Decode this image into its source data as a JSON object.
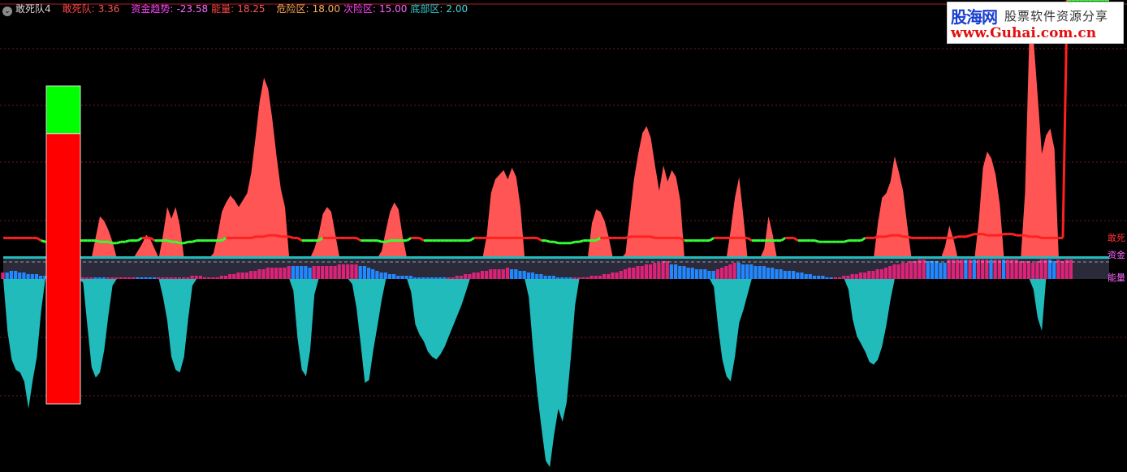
{
  "header": {
    "collapse_icon": "chevron-down-icon",
    "title": "敢死队4",
    "items": [
      {
        "label": "敢死队:",
        "value": "3.36",
        "color": "#ff4444"
      },
      {
        "label": "资金趋势:",
        "value": "-23.58",
        "color": "#ff44ff"
      },
      {
        "label": "能量:",
        "value": "18.25",
        "color": "#ff4444"
      },
      {
        "label": "危险区:",
        "value": "18.00",
        "color": "#ffaa55"
      },
      {
        "label": "次险区:",
        "value": "15.00",
        "color": "#ff44ff"
      },
      {
        "label": "底部区:",
        "value": "2.00",
        "color": "#33cccc"
      }
    ]
  },
  "watermark": {
    "line1": "股海网",
    "line1b": "股票软件资源分享",
    "line2": "www.Guhai.com.cn"
  },
  "right_labels": {
    "dare": "敢死",
    "fund": "资金",
    "energy": "能量"
  },
  "colors": {
    "dare_fill": "#ff5555",
    "fund_fill": "#22bbbb",
    "energy_pos": "#dd2277",
    "energy_neg": "#2288ff",
    "trend_pos": "#ff2020",
    "trend_neg": "#33ff33",
    "grid": "#7a1a1a"
  },
  "chart_data": {
    "type": "area",
    "series": [
      {
        "name": "敢死",
        "values": [
          0,
          0,
          0,
          0,
          0,
          0,
          0,
          0,
          0,
          0,
          0,
          0,
          0,
          0,
          0,
          0,
          0,
          0,
          0,
          0,
          0,
          0,
          9,
          18,
          16,
          12,
          7,
          0,
          0,
          0,
          0,
          0,
          3,
          6,
          10,
          8,
          4,
          0,
          10,
          22,
          17,
          22,
          14,
          0,
          0,
          0,
          0,
          0,
          0,
          0,
          2,
          10,
          20,
          24,
          27,
          25,
          22,
          25,
          28,
          37,
          52,
          68,
          78,
          73,
          60,
          44,
          30,
          22,
          0,
          0,
          0,
          0,
          0,
          0,
          4,
          10,
          19,
          22,
          20,
          10,
          0,
          0,
          0,
          0,
          0,
          0,
          0,
          0,
          0,
          0,
          3,
          12,
          20,
          24,
          21,
          9,
          0,
          0,
          0,
          0,
          0,
          0,
          0,
          0,
          0,
          0,
          0,
          0,
          0,
          0,
          0,
          0,
          0,
          0,
          0,
          10,
          28,
          34,
          36,
          38,
          34,
          39,
          35,
          22,
          0,
          0,
          0,
          0,
          0,
          0,
          0,
          0,
          0,
          0,
          0,
          0,
          0,
          0,
          0,
          0,
          15,
          21,
          20,
          16,
          9,
          0,
          0,
          0,
          2,
          18,
          34,
          45,
          54,
          57,
          52,
          40,
          29,
          40,
          33,
          38,
          35,
          25,
          0,
          0,
          0,
          0,
          0,
          0,
          0,
          0,
          0,
          0,
          0,
          12,
          26,
          35,
          18,
          0,
          0,
          0,
          0,
          4,
          18,
          10,
          0,
          0,
          0,
          0,
          0,
          0,
          0,
          0,
          0,
          0,
          0,
          0,
          0,
          0,
          0,
          0,
          0,
          0,
          0,
          0,
          0,
          0,
          0,
          0,
          15,
          26,
          28,
          33,
          44,
          37,
          29,
          14,
          0,
          0,
          0,
          0,
          0,
          0,
          0,
          0,
          5,
          14,
          8,
          0,
          0,
          0,
          0,
          0,
          16,
          39,
          46,
          43,
          36,
          23,
          0,
          0,
          0,
          0,
          0,
          28,
          95,
          95,
          70,
          45,
          53,
          56,
          47,
          0,
          0,
          0,
          0,
          0,
          0,
          0,
          0,
          0,
          0,
          0,
          0,
          0
        ],
        "color": "#ff5555"
      },
      {
        "name": "资金",
        "values": [
          0,
          -40,
          -62,
          -70,
          -72,
          -79,
          -100,
          -78,
          -60,
          -25,
          0,
          0,
          0,
          0,
          0,
          0,
          0,
          0,
          0,
          -3,
          -36,
          -68,
          -76,
          -72,
          -55,
          -28,
          -5,
          0,
          0,
          0,
          0,
          0,
          0,
          0,
          0,
          0,
          0,
          0,
          -14,
          -32,
          -60,
          -70,
          -72,
          -60,
          -30,
          -5,
          0,
          0,
          0,
          0,
          0,
          0,
          0,
          0,
          0,
          0,
          0,
          0,
          0,
          0,
          0,
          0,
          0,
          0,
          0,
          0,
          0,
          0,
          0,
          -9,
          -46,
          -70,
          -75,
          -55,
          -12,
          0,
          0,
          0,
          0,
          0,
          0,
          0,
          0,
          -4,
          -22,
          -50,
          -80,
          -78,
          -55,
          -36,
          -16,
          0,
          0,
          0,
          0,
          0,
          0,
          -10,
          -35,
          -43,
          -48,
          -56,
          -60,
          -62,
          -58,
          -52,
          -44,
          -36,
          -28,
          -20,
          -10,
          0,
          0,
          0,
          0,
          0,
          0,
          0,
          0,
          0,
          0,
          0,
          0,
          0,
          0,
          -14,
          -54,
          -88,
          -115,
          -140,
          -145,
          -120,
          -100,
          -110,
          -95,
          -60,
          -20,
          0,
          0,
          0,
          0,
          0,
          0,
          0,
          0,
          0,
          0,
          0,
          0,
          0,
          0,
          0,
          0,
          0,
          0,
          0,
          0,
          0,
          0,
          0,
          0,
          0,
          0,
          0,
          0,
          0,
          0,
          0,
          0,
          -6,
          -37,
          -62,
          -75,
          -79,
          -60,
          -34,
          -24,
          -12,
          0,
          0,
          0,
          0,
          0,
          0,
          0,
          0,
          0,
          0,
          0,
          0,
          0,
          0,
          0,
          0,
          0,
          0,
          0,
          0,
          0,
          0,
          0,
          -8,
          -31,
          -44,
          -50,
          -56,
          -64,
          -66,
          -62,
          -52,
          -36,
          -16,
          0,
          0,
          0,
          0,
          0,
          0,
          0,
          0,
          0,
          0,
          0,
          0,
          0,
          0,
          0,
          0,
          0,
          0,
          0,
          0,
          0,
          0,
          0,
          0,
          0,
          0,
          0,
          0,
          0,
          0,
          0,
          0,
          0,
          -8,
          -30,
          -40,
          0,
          0,
          0,
          0,
          0,
          0,
          0,
          0,
          0,
          0,
          0,
          0,
          0,
          0,
          0,
          0,
          0,
          0,
          0,
          0,
          0,
          0,
          0,
          0,
          0,
          0,
          0,
          -9,
          -52,
          -68,
          -94,
          -98,
          -86,
          -68,
          -48,
          0,
          0
        ],
        "color": "#22bbbb"
      },
      {
        "name": "能量",
        "values": [
          4,
          -4,
          -5,
          -5,
          -4,
          -4,
          -3,
          -3,
          -3,
          -2,
          -2,
          -1,
          -1,
          1,
          1,
          1,
          1,
          2,
          2,
          1,
          1,
          1,
          -1,
          -1,
          -1,
          1,
          1,
          1,
          1,
          1,
          1,
          1,
          -1,
          -1,
          -1,
          -1,
          -1,
          1,
          1,
          1,
          1,
          1,
          1,
          1,
          1,
          2,
          2,
          2,
          1,
          1,
          1,
          1,
          2,
          2,
          3,
          3,
          4,
          4,
          4,
          5,
          5,
          6,
          6,
          7,
          7,
          7,
          7,
          7,
          8,
          -8,
          -8,
          -8,
          -8,
          -7,
          8,
          8,
          8,
          8,
          8,
          8,
          9,
          9,
          9,
          9,
          9,
          -8,
          -8,
          -7,
          -6,
          -5,
          -4,
          -4,
          -3,
          -3,
          -2,
          -2,
          -2,
          -2,
          -1,
          -1,
          -1,
          -1,
          -1,
          -1,
          -1,
          -1,
          1,
          1,
          2,
          2,
          3,
          3,
          4,
          4,
          5,
          5,
          6,
          6,
          6,
          6,
          7,
          -6,
          -6,
          -5,
          -5,
          -4,
          -4,
          -3,
          -3,
          -2,
          -2,
          -2,
          -1,
          -1,
          -1,
          -1,
          1,
          1,
          1,
          1,
          2,
          2,
          2,
          3,
          3,
          4,
          4,
          5,
          6,
          7,
          7,
          8,
          8,
          9,
          9,
          10,
          10,
          11,
          11,
          -9,
          -9,
          -8,
          -8,
          -7,
          -7,
          -6,
          -6,
          -6,
          -5,
          -5,
          6,
          7,
          8,
          9,
          10,
          -10,
          -9,
          -9,
          -9,
          -8,
          -8,
          -8,
          -7,
          -7,
          -6,
          -6,
          -5,
          -5,
          -5,
          -4,
          -4,
          -3,
          -3,
          -2,
          -2,
          -2,
          -1,
          -1,
          1,
          1,
          2,
          2,
          3,
          3,
          4,
          4,
          5,
          5,
          6,
          6,
          7,
          8,
          9,
          9,
          10,
          10,
          11,
          11,
          12,
          12,
          -11,
          -11,
          -11,
          -10,
          -10,
          12,
          12,
          13,
          13,
          -12,
          12,
          -12,
          13,
          13,
          13,
          -13,
          13,
          13,
          -13,
          12,
          12,
          12,
          11,
          11,
          11,
          10,
          11,
          12,
          13,
          -12,
          -11,
          12,
          11,
          13,
          13
        ],
        "color": "#dd2277"
      },
      {
        "name": "资金趋势",
        "values": [
          1,
          1,
          1,
          1,
          1,
          1,
          1,
          1,
          1,
          -1,
          -2,
          -2,
          -2,
          -1,
          -1,
          -1,
          -1,
          -1,
          -1,
          -1,
          -1,
          -1,
          -1,
          -2,
          -2,
          -2,
          -3,
          -3,
          -2,
          -2,
          -1,
          -1,
          -1,
          1,
          1,
          1,
          -1,
          -1,
          -1,
          -1,
          -2,
          -2,
          -3,
          -3,
          -2,
          -2,
          -1,
          -1,
          -1,
          -1,
          -1,
          -1,
          -1,
          1,
          1,
          1,
          1,
          1,
          1,
          1,
          2,
          2,
          2,
          3,
          3,
          3,
          2,
          2,
          2,
          1,
          1,
          -1,
          -1,
          -1,
          -1,
          -1,
          1,
          1,
          1,
          1,
          1,
          1,
          1,
          1,
          1,
          -1,
          -1,
          -1,
          -1,
          -1,
          -2,
          -2,
          -1,
          -1,
          -1,
          -1,
          -1,
          1,
          1,
          1,
          -1,
          -1,
          -1,
          -1,
          -1,
          -1,
          -1,
          -1,
          -1,
          -1,
          -1,
          -1,
          1,
          1,
          1,
          1,
          1,
          1,
          1,
          1,
          1,
          1,
          1,
          1,
          1,
          1,
          1,
          1,
          -1,
          -1,
          -2,
          -2,
          -3,
          -3,
          -3,
          -3,
          -2,
          -2,
          -1,
          -1,
          -1,
          -1,
          1,
          1,
          1,
          1,
          1,
          1,
          1,
          2,
          2,
          2,
          2,
          2,
          2,
          1,
          1,
          1,
          1,
          1,
          1,
          1,
          -1,
          -1,
          -1,
          -1,
          -1,
          -1,
          -1,
          1,
          1,
          1,
          1,
          1,
          1,
          1,
          1,
          1,
          -1,
          -1,
          -1,
          -1,
          -1,
          -1,
          -1,
          -1,
          1,
          1,
          1,
          -1,
          -1,
          -1,
          -1,
          -1,
          -2,
          -2,
          -2,
          -2,
          -2,
          -2,
          -2,
          -1,
          -1,
          -1,
          -1,
          1,
          1,
          1,
          2,
          2,
          2,
          3,
          3,
          3,
          2,
          2,
          1,
          1,
          1,
          1,
          1,
          1,
          1,
          1,
          1,
          1,
          1,
          2,
          2,
          2,
          3,
          4,
          4,
          4,
          3,
          3,
          3,
          3,
          4,
          4,
          4,
          3,
          3,
          3,
          2,
          2,
          2,
          1,
          1,
          1,
          1,
          1,
          1
        ],
        "color": "#ff2020"
      }
    ],
    "ref_lines": [
      {
        "name": "危险区",
        "value": 18
      },
      {
        "name": "次险区",
        "value": 15
      },
      {
        "name": "底部区",
        "value": 2
      }
    ],
    "current_bar": {
      "top": 100,
      "split": 85,
      "bottom": 0,
      "upper_color": "#00ff00",
      "lower_color": "#ff0000"
    },
    "grid": "dotted horizontal"
  }
}
